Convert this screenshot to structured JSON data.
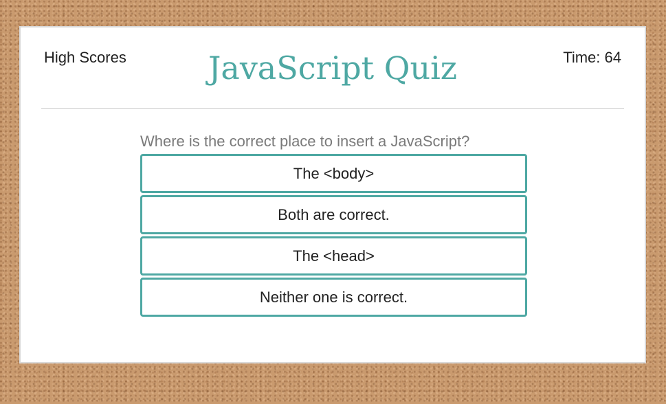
{
  "header": {
    "high_scores_label": "High Scores",
    "title": "JavaScript Quiz",
    "timer_text": "Time: 64"
  },
  "quiz": {
    "question": "Where is the correct place to insert a JavaScript?",
    "answers": [
      "The <body>",
      "Both are correct.",
      "The <head>",
      "Neither one is correct."
    ]
  },
  "colors": {
    "accent": "#4ea8a3",
    "background": "#c99a6e",
    "card": "#ffffff",
    "question_text": "#7a7a7a"
  }
}
